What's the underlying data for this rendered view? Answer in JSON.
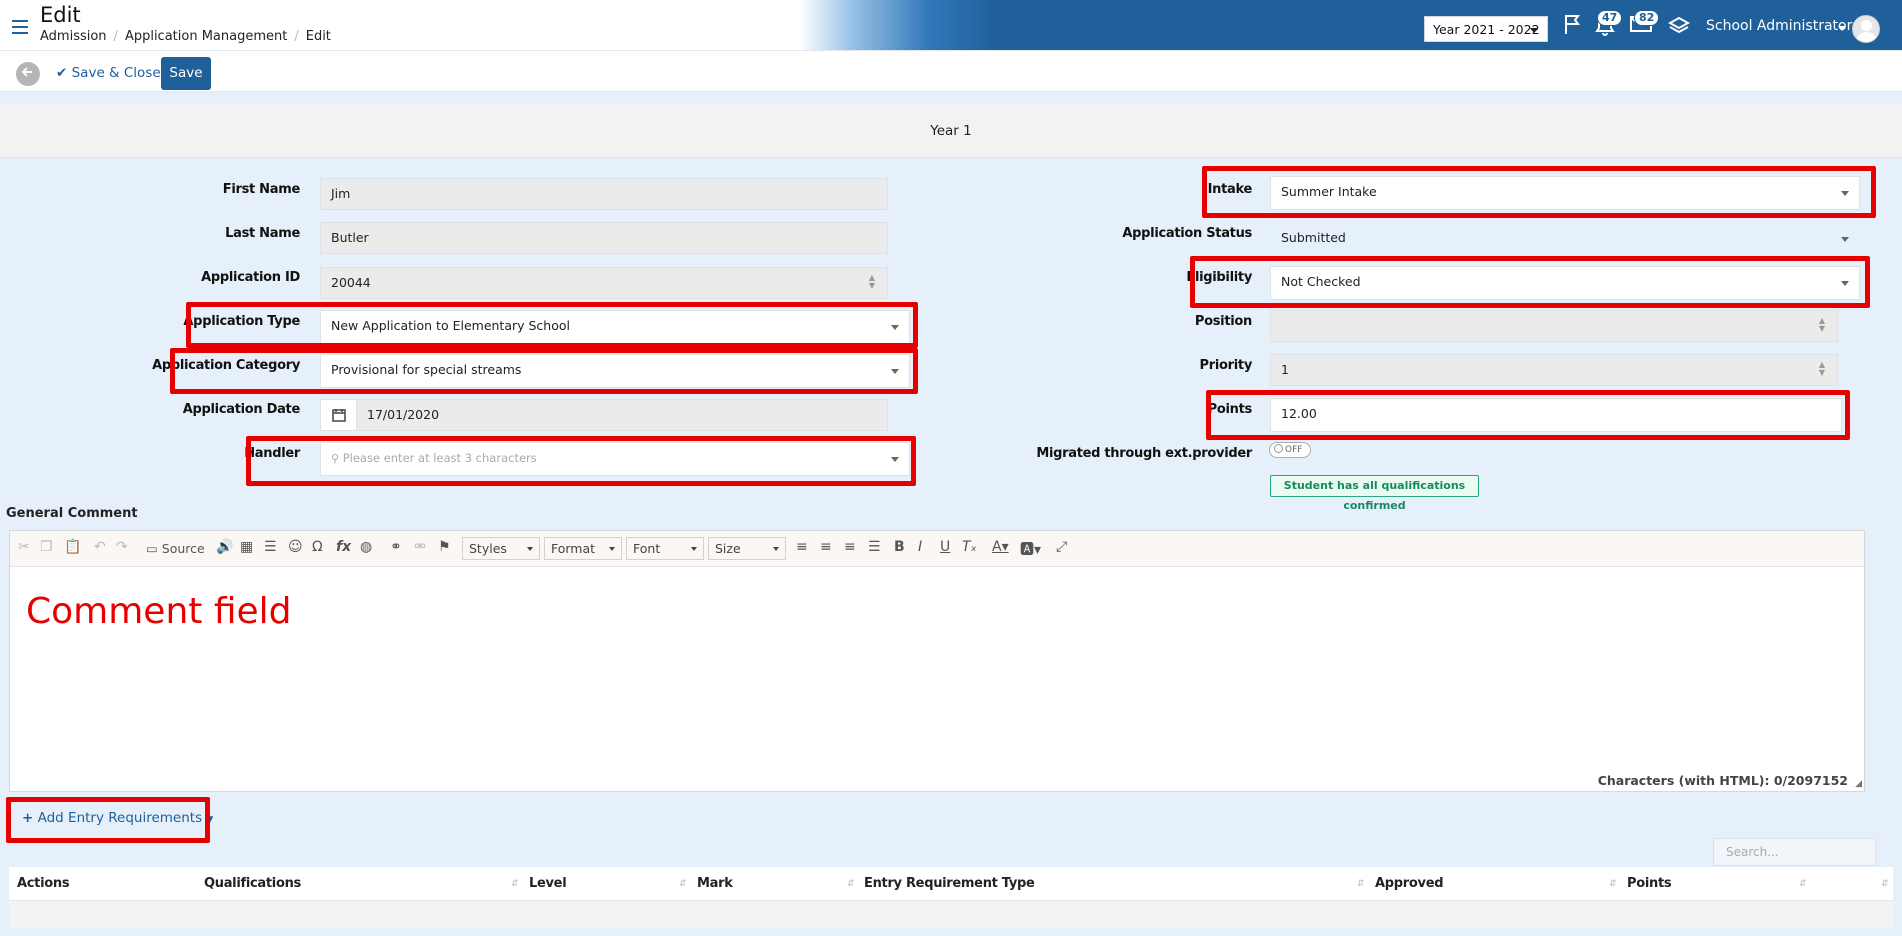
{
  "header": {
    "title": "Edit",
    "breadcrumb": [
      "Admission",
      "Application Management",
      "Edit"
    ],
    "year_select": "Year 2021 - 2022",
    "notifications_count": "47",
    "messages_count": "82",
    "user_name": "School Administrator"
  },
  "actions": {
    "save_close_label": "Save & Close",
    "save_label": "Save"
  },
  "form": {
    "year_band": "Year 1",
    "first_name": {
      "label": "First Name",
      "value": "Jim"
    },
    "last_name": {
      "label": "Last Name",
      "value": "Butler"
    },
    "application_id": {
      "label": "Application ID",
      "value": "20044"
    },
    "application_type": {
      "label": "Application Type",
      "value": "New Application to Elementary School"
    },
    "application_category": {
      "label": "Application Category",
      "value": "Provisional for special streams"
    },
    "application_date": {
      "label": "Application Date",
      "value": "17/01/2020"
    },
    "handler": {
      "label": "Handler",
      "placeholder": "Please enter at least 3 characters"
    },
    "intake": {
      "label": "Intake",
      "value": "Summer Intake"
    },
    "application_status": {
      "label": "Application Status",
      "value": "Submitted"
    },
    "eligibility": {
      "label": "Eligibility",
      "value": "Not Checked"
    },
    "position": {
      "label": "Position",
      "value": ""
    },
    "priority": {
      "label": "Priority",
      "value": "1"
    },
    "points": {
      "label": "Points",
      "value": "12.00"
    },
    "migrated": {
      "label": "Migrated through ext.provider",
      "toggle": "OFF"
    },
    "qualifications_badge": "Student has all qualifications confirmed"
  },
  "editor": {
    "label": "General Comment",
    "source_label": "Source",
    "styles": "Styles",
    "format": "Format",
    "font": "Font",
    "size": "Size",
    "content": "Comment field",
    "char_count": "Characters (with HTML): 0/2097152"
  },
  "requirements": {
    "add_label": "Add Entry Requirements",
    "search_placeholder": "Search...",
    "columns": [
      "Actions",
      "Qualifications",
      "Level",
      "Mark",
      "Entry Requirement Type",
      "Approved",
      "Points"
    ]
  },
  "colors": {
    "primary": "#1f5f9a",
    "highlight": "#e60000",
    "form_background": "#e6f0fa",
    "success": "#168a5f"
  }
}
